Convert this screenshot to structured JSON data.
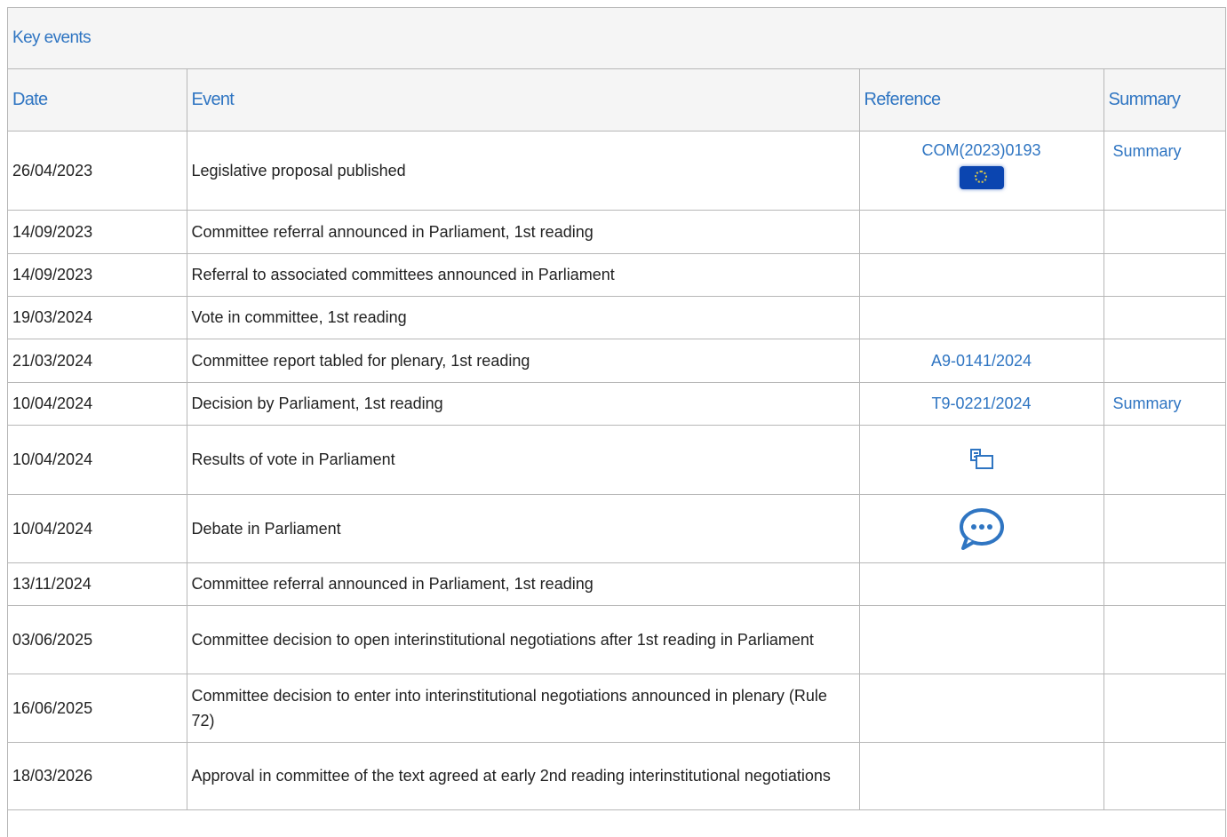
{
  "panel": {
    "title": "Key events"
  },
  "columns": {
    "date": "Date",
    "event": "Event",
    "reference": "Reference",
    "summary": "Summary"
  },
  "rows": [
    {
      "date": "26/04/2023",
      "event": "Legislative proposal published",
      "reference": "COM(2023)0193",
      "ref_icon": "eu-flag-icon",
      "summary": "Summary"
    },
    {
      "date": "14/09/2023",
      "event": "Committee referral announced in Parliament, 1st reading",
      "reference": "",
      "summary": ""
    },
    {
      "date": "14/09/2023",
      "event": "Referral to associated committees announced in Parliament",
      "reference": "",
      "summary": ""
    },
    {
      "date": "19/03/2024",
      "event": "Vote in committee, 1st reading",
      "reference": "",
      "summary": ""
    },
    {
      "date": "21/03/2024",
      "event": "Committee report tabled for plenary, 1st reading",
      "reference": "A9-0141/2024",
      "summary": ""
    },
    {
      "date": "10/04/2024",
      "event": "Decision by Parliament, 1st reading",
      "reference": "T9-0221/2024",
      "summary": "Summary"
    },
    {
      "date": "10/04/2024",
      "event": "Results of vote in Parliament",
      "reference": "",
      "ref_icon": "vote-results-icon",
      "summary": ""
    },
    {
      "date": "10/04/2024",
      "event": "Debate in Parliament",
      "reference": "",
      "ref_icon": "debate-icon",
      "summary": ""
    },
    {
      "date": "13/11/2024",
      "event": "Committee referral announced in Parliament, 1st reading",
      "reference": "",
      "summary": ""
    },
    {
      "date": "03/06/2025",
      "event": "Committee decision to open interinstitutional negotiations after 1st reading in Parliament",
      "reference": "",
      "summary": ""
    },
    {
      "date": "16/06/2025",
      "event": "Committee decision to enter into interinstitutional negotiations announced in plenary (Rule 72)",
      "reference": "",
      "summary": ""
    },
    {
      "date": "18/03/2026",
      "event": "Approval in committee of the text agreed at early 2nd reading interinstitutional negotiations",
      "reference": "",
      "summary": ""
    }
  ],
  "colors": {
    "link": "#2f75c2",
    "header_bg": "#f5f5f5",
    "border": "#b7b7b7",
    "eu_flag": "#0b45b0"
  }
}
